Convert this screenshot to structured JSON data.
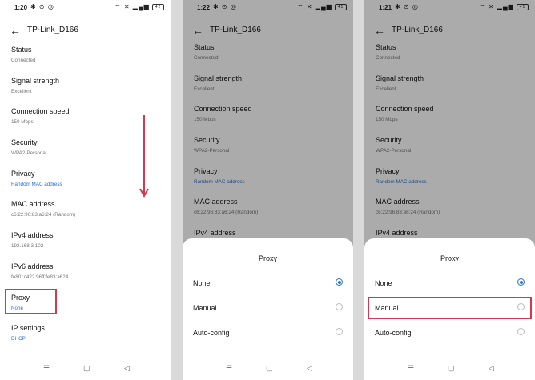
{
  "panels": [
    {
      "status": {
        "time": "1:20",
        "battery": "42"
      },
      "title": "TP-Link_D166",
      "items": [
        {
          "label": "Status",
          "value": "Connected"
        },
        {
          "label": "Signal strength",
          "value": "Excellent"
        },
        {
          "label": "Connection speed",
          "value": "150 Mbps"
        },
        {
          "label": "Security",
          "value": "WPA2-Personal"
        },
        {
          "label": "Privacy",
          "value": "Random MAC address"
        },
        {
          "label": "MAC address",
          "value": "c6:22:96:83:a6:24 (Random)"
        },
        {
          "label": "IPv4 address",
          "value": "192.168.3.102"
        },
        {
          "label": "IPv6 address",
          "value": "fe80::c422:96ff:fe83:a624"
        },
        {
          "label": "Proxy",
          "value": "None"
        },
        {
          "label": "IP settings",
          "value": "DHCP"
        }
      ]
    },
    {
      "status": {
        "time": "1:22",
        "battery": "41"
      },
      "title": "TP-Link_D166",
      "items": [
        {
          "label": "Status",
          "value": "Connected"
        },
        {
          "label": "Signal strength",
          "value": "Excellent"
        },
        {
          "label": "Connection speed",
          "value": "150 Mbps"
        },
        {
          "label": "Security",
          "value": "WPA2-Personal"
        },
        {
          "label": "Privacy",
          "value": "Random MAC address"
        },
        {
          "label": "MAC address",
          "value": "c6:22:96:83:a6:24 (Random)"
        },
        {
          "label": "IPv4 address",
          "value": ""
        }
      ],
      "sheet": {
        "title": "Proxy",
        "options": [
          "None",
          "Manual",
          "Auto-config"
        ],
        "selected": 0
      }
    },
    {
      "status": {
        "time": "1:21",
        "battery": "41"
      },
      "title": "TP-Link_D166",
      "items": [
        {
          "label": "Status",
          "value": "Connected"
        },
        {
          "label": "Signal strength",
          "value": "Excellent"
        },
        {
          "label": "Connection speed",
          "value": "150 Mbps"
        },
        {
          "label": "Security",
          "value": "WPA2-Personal"
        },
        {
          "label": "Privacy",
          "value": "Random MAC address"
        },
        {
          "label": "MAC address",
          "value": "c6:22:96:83:a6:24 (Random)"
        },
        {
          "label": "IPv4 address",
          "value": ""
        }
      ],
      "sheet": {
        "title": "Proxy",
        "options": [
          "None",
          "Manual",
          "Auto-config"
        ],
        "selected": 0
      }
    }
  ],
  "colors": {
    "accent": "#2b6fd6",
    "highlight": "#d2394f"
  },
  "nav_icons": {
    "menu": "menu-icon",
    "home": "home-icon",
    "back": "back-icon"
  }
}
